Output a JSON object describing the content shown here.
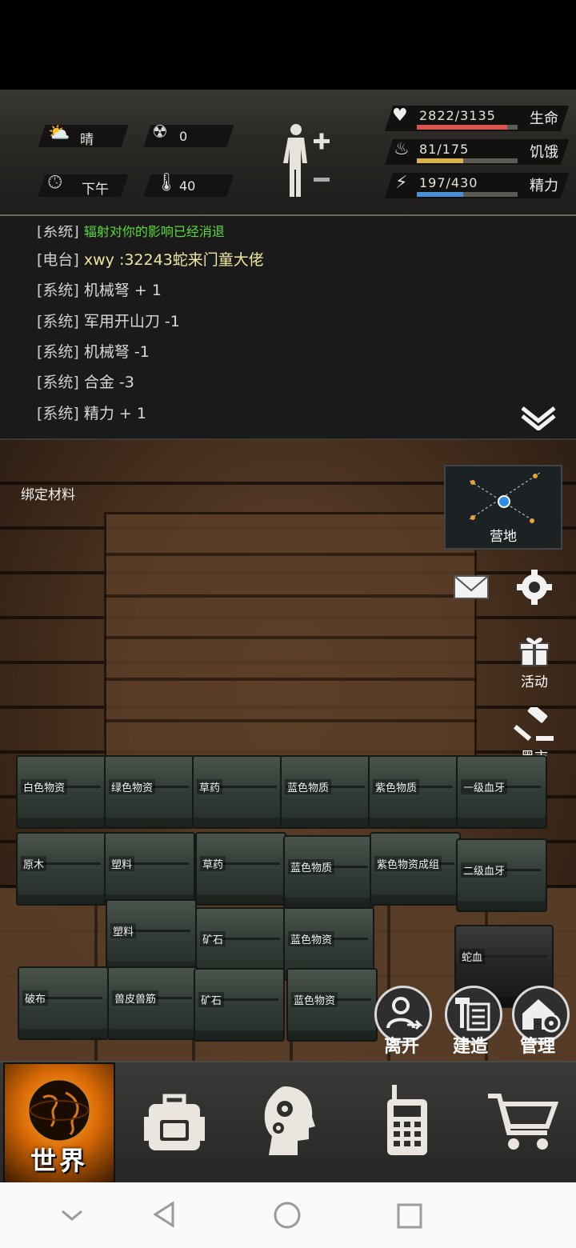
{
  "status": {
    "weather_label": "晴",
    "radiation_value": "0",
    "time_label": "下午",
    "temperature_value": "40",
    "health": {
      "value": "2822/3135",
      "label": "生命",
      "fraction": 0.9,
      "color": "#d9534f"
    },
    "hunger": {
      "value": "81/175",
      "label": "饥饿",
      "fraction": 0.46,
      "color": "#d8b24a"
    },
    "energy": {
      "value": "197/430",
      "label": "精力",
      "fraction": 0.46,
      "color": "#4a8fd8"
    }
  },
  "log": {
    "lines": [
      {
        "tag": "[系统]",
        "text": "辐射对你的影响已经消退"
      },
      {
        "tag": "[电台]",
        "text": "xwy :32243蛇来门童大佬"
      },
      {
        "tag": "[系统]",
        "text": "机械弩 + 1"
      },
      {
        "tag": "[系统]",
        "text": "军用开山刀 -1"
      },
      {
        "tag": "[系统]",
        "text": "机械弩 -1"
      },
      {
        "tag": "[系统]",
        "text": "合金 -3"
      },
      {
        "tag": "[系统]",
        "text": "精力 + 1"
      }
    ]
  },
  "scene": {
    "bind_label": "绑定材料",
    "minimap_label": "营地",
    "activity_label": "活动",
    "blackmarket_label": "黑市",
    "crates": [
      {
        "label": "白色物资"
      },
      {
        "label": "绿色物资"
      },
      {
        "label": "草药"
      },
      {
        "label": "蓝色物质"
      },
      {
        "label": "紫色物质"
      },
      {
        "label": "一级血牙"
      },
      {
        "label": "原木"
      },
      {
        "label": "塑料"
      },
      {
        "label": "草药"
      },
      {
        "label": "蓝色物质"
      },
      {
        "label": "紫色物资成组"
      },
      {
        "label": "二级血牙"
      },
      {
        "label": "塑料"
      },
      {
        "label": "矿石"
      },
      {
        "label": "蓝色物资"
      },
      {
        "label": "蛇血"
      },
      {
        "label": "破布"
      },
      {
        "label": "兽皮兽筋"
      },
      {
        "label": "矿石"
      },
      {
        "label": "蓝色物资"
      }
    ],
    "leave_label": "离开",
    "build_label": "建造",
    "manage_label": "管理"
  },
  "tabs": {
    "world_label": "世界"
  }
}
